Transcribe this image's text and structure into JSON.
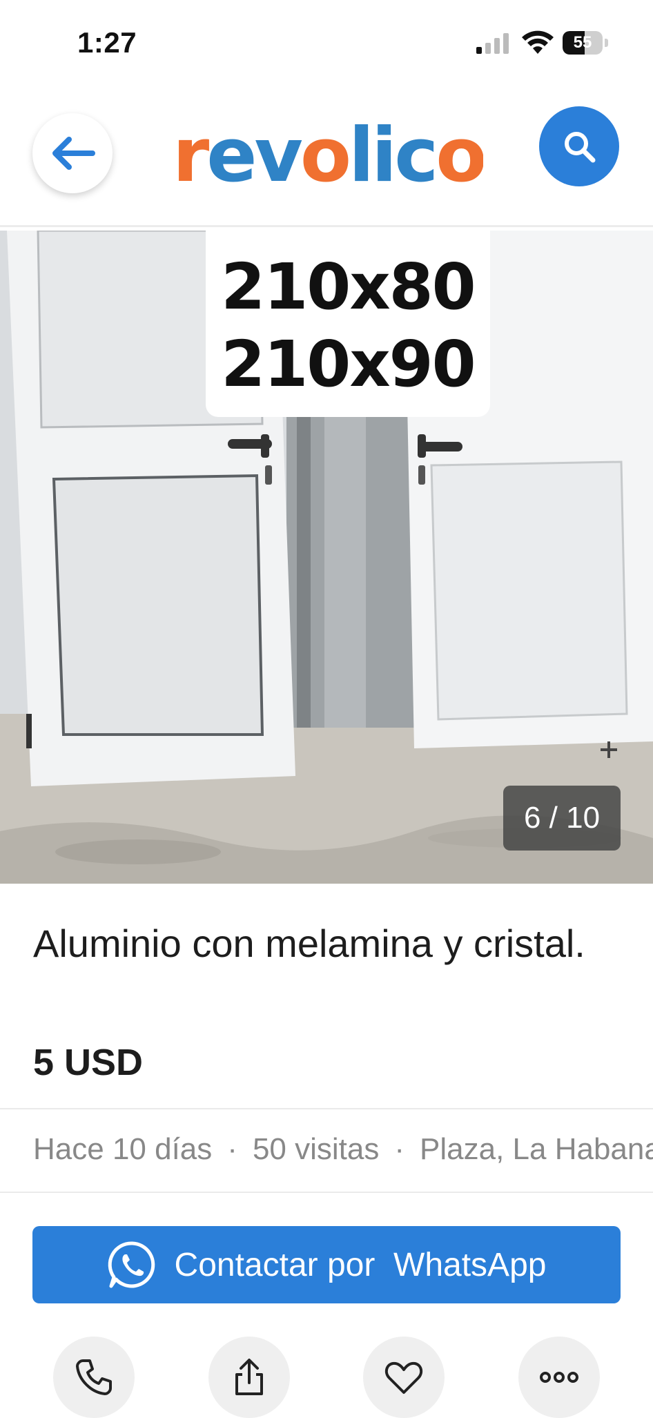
{
  "status_bar": {
    "time": "1:27",
    "battery": "55"
  },
  "header": {
    "logo_text": "revolico"
  },
  "gallery": {
    "image_sizes": [
      "210x80",
      "210x90"
    ],
    "counter": "6 / 10"
  },
  "listing": {
    "title": "Aluminio con melamina y cristal.",
    "price": "5 USD",
    "posted": "Hace 10 días",
    "visits": "50 visitas",
    "location": "Plaza, La Habana",
    "separator": "·"
  },
  "contact": {
    "whatsapp_label": "Contactar por  WhatsApp"
  },
  "actions": [
    "phone-icon",
    "share-icon",
    "heart-icon",
    "more-icon"
  ],
  "colors": {
    "primary": "#2b7fd9",
    "logo_orange": "#f07030",
    "logo_blue": "#2f83c6"
  }
}
